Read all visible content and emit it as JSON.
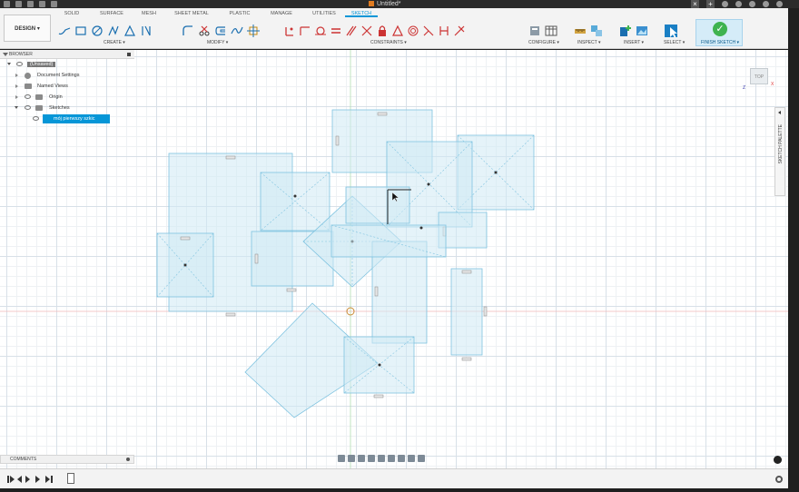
{
  "window": {
    "doc_title": "Untitled*"
  },
  "ribbon": {
    "workspace_label": "DESIGN",
    "tabs": [
      {
        "label": "SOLID",
        "active": false
      },
      {
        "label": "SURFACE",
        "active": false
      },
      {
        "label": "MESH",
        "active": false
      },
      {
        "label": "SHEET METAL",
        "active": false
      },
      {
        "label": "PLASTIC",
        "active": false
      },
      {
        "label": "MANAGE",
        "active": false
      },
      {
        "label": "UTILITIES",
        "active": false
      },
      {
        "label": "SKETCH",
        "active": true
      }
    ],
    "groups": {
      "create": "CREATE",
      "modify": "MODIFY",
      "constraints": "CONSTRAINTS",
      "configure": "CONFIGURE",
      "inspect": "INSPECT",
      "insert": "INSERT",
      "select": "SELECT"
    },
    "finish_sketch_label": "FINISH SKETCH",
    "accent": "#0696d7",
    "finish_color": "#3fb34f"
  },
  "browser": {
    "header": "BROWSER",
    "items": [
      {
        "label": "(Unsaved)",
        "level": 0
      },
      {
        "label": "Document Settings",
        "level": 1
      },
      {
        "label": "Named Views",
        "level": 1
      },
      {
        "label": "Origin",
        "level": 1
      },
      {
        "label": "Sketches",
        "level": 1
      },
      {
        "label": "mój pierwszy szkic",
        "level": 2,
        "selected": true
      }
    ]
  },
  "viewcube": {
    "face_label": "TOP",
    "axis_x": "X",
    "axis_z": "Z"
  },
  "sketch_palette": {
    "label": "SKETCH PALETTE"
  },
  "comments": {
    "label": "COMMENTS"
  },
  "sketch": {
    "fill_color": "#cfe9f4",
    "stroke_color": "#7fc3e0"
  }
}
